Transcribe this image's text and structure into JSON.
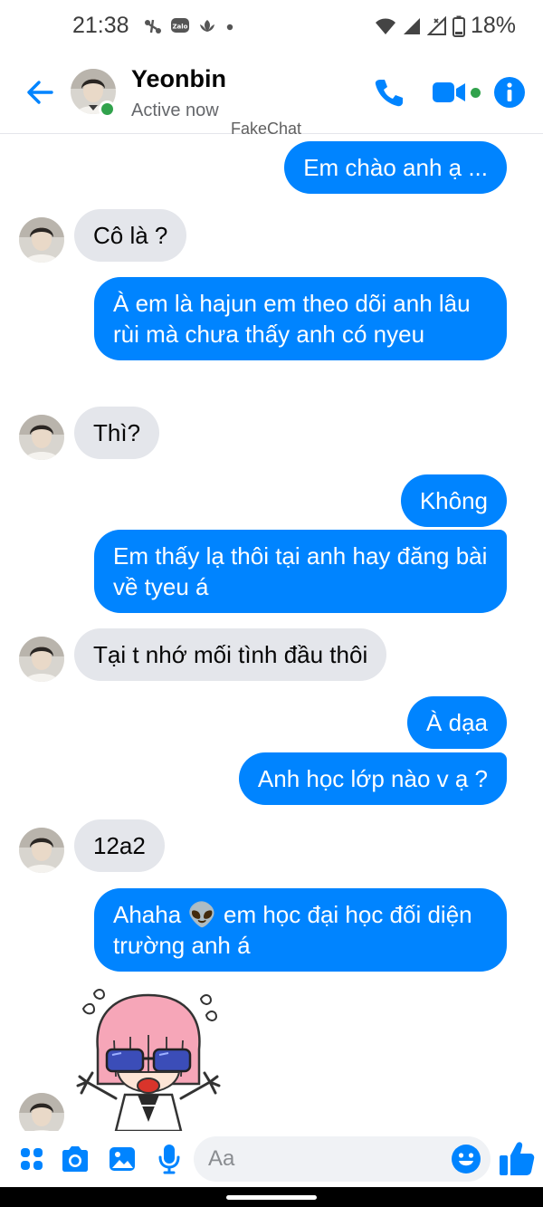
{
  "status_bar": {
    "time": "21:38",
    "battery": "18%",
    "icons": [
      "phone-link-icon",
      "zalo-icon",
      "lotus-app-icon",
      "notification-dot-icon",
      "wifi-icon",
      "signal-icon",
      "signal-x-icon",
      "battery-icon"
    ]
  },
  "header": {
    "name": "Yeonbin",
    "status": "Active now",
    "watermark": "FakeChat",
    "icons": [
      "back-arrow-icon",
      "phone-icon",
      "video-camera-icon",
      "info-icon"
    ]
  },
  "messages": [
    {
      "side": "out",
      "text": "Em chào anh ạ ..."
    },
    {
      "side": "in",
      "text": "Cô là ?"
    },
    {
      "side": "out",
      "text": "À em là hajun em theo dõi anh lâu rùi mà chưa thấy anh có nyeu"
    },
    {
      "side": "in",
      "text": "Thì?"
    },
    {
      "side": "out",
      "text": "Không"
    },
    {
      "side": "out",
      "text": "Em thấy lạ thôi tại anh hay đăng bài về tyeu á"
    },
    {
      "side": "in",
      "text": "Tại t nhớ mối tình đầu thôi"
    },
    {
      "side": "out",
      "text": "À dạa"
    },
    {
      "side": "out",
      "text": "Anh học lớp nào v ạ ?"
    },
    {
      "side": "in",
      "text": "12a2"
    },
    {
      "side": "out",
      "text": "Ahaha 👽 em học đại học đối diện trường anh á"
    },
    {
      "side": "in",
      "type": "sticker",
      "text": ""
    }
  ],
  "composer": {
    "placeholder": "Aa",
    "icons": [
      "menu-dots-icon",
      "camera-icon",
      "gallery-icon",
      "microphone-icon",
      "emoji-icon",
      "thumbs-up-icon"
    ]
  },
  "colors": {
    "accent": "#0084ff",
    "incoming_bubble": "#e4e6eb",
    "active": "#31a24c"
  }
}
